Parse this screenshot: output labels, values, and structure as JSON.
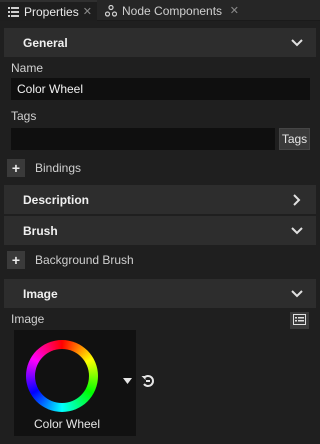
{
  "tabs": [
    {
      "label": "Properties",
      "icon": "list-icon",
      "active": true
    },
    {
      "label": "Node Components",
      "icon": "components-icon",
      "active": false
    }
  ],
  "close_glyph": "✕",
  "sections": {
    "general": {
      "title": "General",
      "expanded": true
    },
    "description": {
      "title": "Description",
      "expanded": false
    },
    "brush": {
      "title": "Brush",
      "expanded": true
    },
    "image": {
      "title": "Image",
      "expanded": true
    }
  },
  "fields": {
    "name_label": "Name",
    "name_value": "Color Wheel",
    "tags_label": "Tags",
    "tags_value": "",
    "tags_button": "Tags"
  },
  "bindings_label": "Bindings",
  "background_brush_label": "Background Brush",
  "image_property": {
    "label": "Image",
    "value": "Color Wheel"
  },
  "plus_glyph": "+",
  "colors": {
    "background": "#1f1f1f",
    "section_header": "#2d2d2d",
    "field_bg": "#0f0f0f"
  }
}
